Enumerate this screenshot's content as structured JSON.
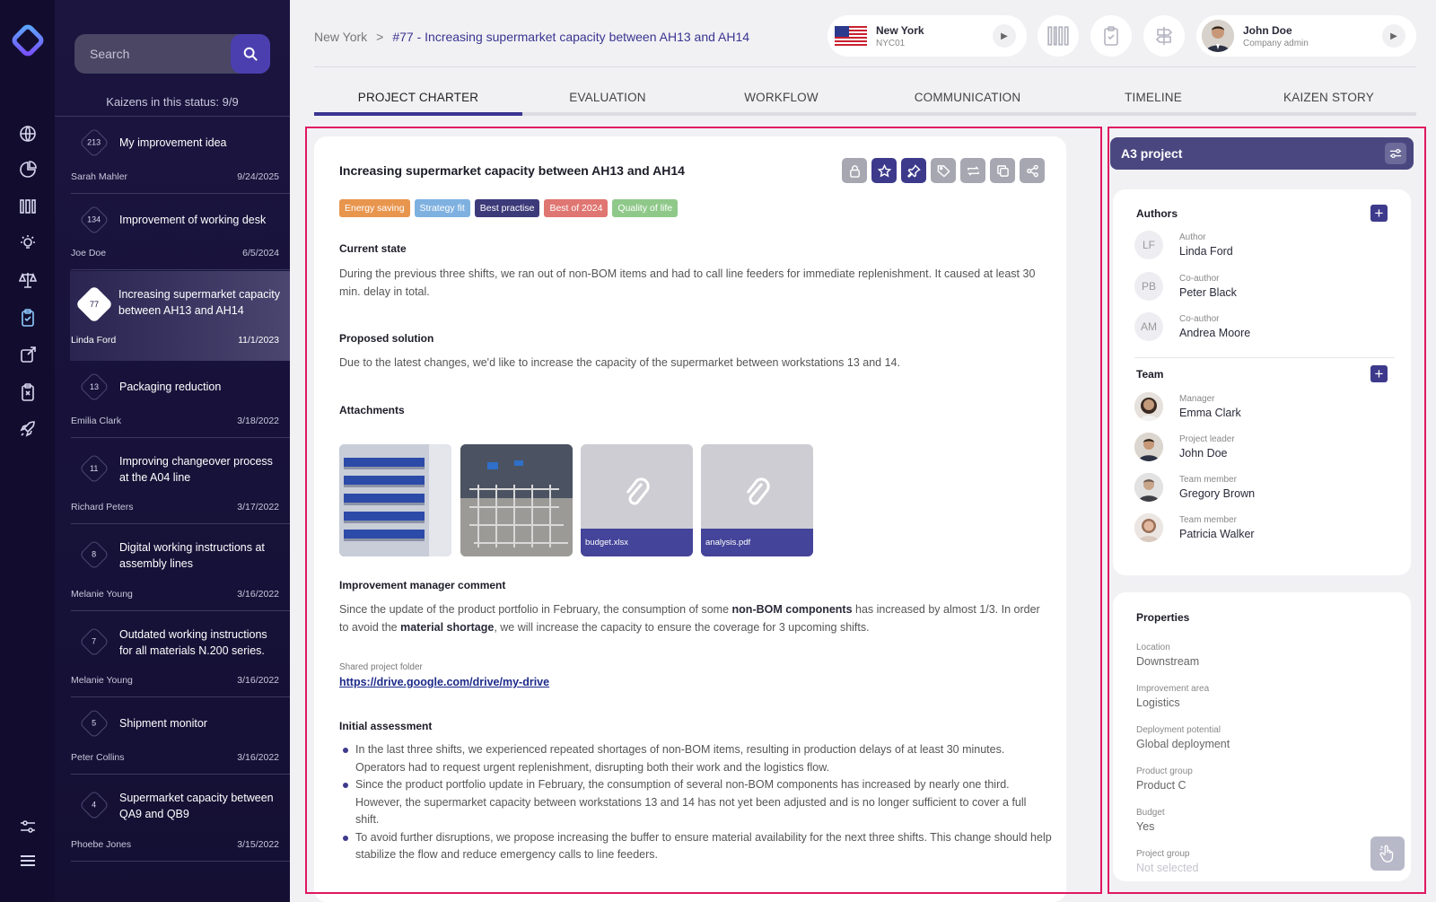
{
  "sidebar": {
    "search_placeholder": "Search",
    "status_count": "Kaizens in this status: 9/9",
    "items": [
      {
        "num": "213",
        "title": "My improvement idea",
        "author": "Sarah Mahler",
        "date": "9/24/2025"
      },
      {
        "num": "134",
        "title": "Improvement of working desk",
        "author": "Joe Doe",
        "date": "6/5/2024"
      },
      {
        "num": "77",
        "title": "Increasing supermarket capacity between AH13 and AH14",
        "author": "Linda Ford",
        "date": "11/1/2023"
      },
      {
        "num": "13",
        "title": "Packaging reduction",
        "author": "Emilia Clark",
        "date": "3/18/2022"
      },
      {
        "num": "11",
        "title": "Improving changeover process at the A04 line",
        "author": "Richard Peters",
        "date": "3/17/2022"
      },
      {
        "num": "8",
        "title": "Digital working instructions at assembly lines",
        "author": "Melanie Young",
        "date": "3/16/2022"
      },
      {
        "num": "7",
        "title": "Outdated working instructions for all materials N.200 series.",
        "author": "Melanie Young",
        "date": "3/16/2022"
      },
      {
        "num": "5",
        "title": "Shipment monitor",
        "author": "Peter Collins",
        "date": "3/16/2022"
      },
      {
        "num": "4",
        "title": "Supermarket capacity between QA9 and QB9",
        "author": "Phoebe Jones",
        "date": "3/15/2022"
      }
    ]
  },
  "header": {
    "breadcrumb_root": "New York",
    "breadcrumb_sep": ">",
    "breadcrumb_current": "#77 - Increasing supermarket capacity between AH13 and AH14",
    "location_name": "New York",
    "location_code": "NYC01",
    "user_name": "John Doe",
    "user_role": "Company admin"
  },
  "tabs": [
    "PROJECT CHARTER",
    "EVALUATION",
    "WORKFLOW",
    "COMMUNICATION",
    "TIMELINE",
    "KAIZEN STORY"
  ],
  "charter": {
    "title": "Increasing supermarket capacity between AH13 and AH14",
    "tags": [
      {
        "label": "Energy saving",
        "color": "#e8954e"
      },
      {
        "label": "Strategy fit",
        "color": "#7fb1e0"
      },
      {
        "label": "Best practise",
        "color": "#3d3a7a"
      },
      {
        "label": "Best of 2024",
        "color": "#e07672"
      },
      {
        "label": "Quality of life",
        "color": "#8fc98a"
      }
    ],
    "current_state_h": "Current state",
    "current_state": "During the previous three shifts, we ran out of non-BOM items and had to call line feeders for immediate replenishment. It caused at least 30 min. delay in total.",
    "proposed_h": "Proposed solution",
    "proposed": "Due to the latest changes, we'd like to increase the capacity of the supermarket between workstations 13 and 14.",
    "attachments_h": "Attachments",
    "attachments": [
      "budget.xlsx",
      "analysis.pdf"
    ],
    "comment_h": "Improvement manager comment",
    "comment_1": "Since the update of the product portfolio in February, the consumption of some ",
    "comment_b1": "non-BOM components",
    "comment_2": " has increased by almost 1/3. In order to avoid the ",
    "comment_b2": "material shortage",
    "comment_3": ", we will increase the capacity to ensure the coverage for 3 upcoming shifts.",
    "folder_label": "Shared project folder",
    "folder_link": "https://drive.google.com/drive/my-drive",
    "assessment_h": "Initial assessment",
    "assessment": [
      "In the last three shifts, we experienced repeated shortages of non-BOM items, resulting in production delays of at least 30 minutes. Operators had to request urgent replenishment, disrupting both their work and the logistics flow.",
      "Since the product portfolio update in February, the consumption of several non-BOM components has increased by nearly one third. However, the supermarket capacity between workstations 13 and 14 has not yet been adjusted and is no longer sufficient to cover a full shift.",
      "To avoid further disruptions, we propose increasing the buffer to ensure material availability for the next three shifts. This change should help stabilize the flow and reduce emergency calls to line feeders."
    ]
  },
  "a3": {
    "title": "A3 project",
    "authors_h": "Authors",
    "authors": [
      {
        "initials": "LF",
        "role": "Author",
        "name": "Linda Ford"
      },
      {
        "initials": "PB",
        "role": "Co-author",
        "name": "Peter Black"
      },
      {
        "initials": "AM",
        "role": "Co-author",
        "name": "Andrea Moore"
      }
    ],
    "team_h": "Team",
    "team": [
      {
        "role": "Manager",
        "name": "Emma Clark"
      },
      {
        "role": "Project leader",
        "name": "John Doe"
      },
      {
        "role": "Team member",
        "name": "Gregory Brown"
      },
      {
        "role": "Team member",
        "name": "Patricia Walker"
      }
    ],
    "properties_h": "Properties",
    "properties": [
      {
        "key": "Location",
        "value": "Downstream"
      },
      {
        "key": "Improvement area",
        "value": "Logistics"
      },
      {
        "key": "Deployment potential",
        "value": "Global deployment"
      },
      {
        "key": "Product group",
        "value": "Product C"
      },
      {
        "key": "Budget",
        "value": "Yes"
      },
      {
        "key": "Project group",
        "value": "Not selected"
      }
    ]
  }
}
